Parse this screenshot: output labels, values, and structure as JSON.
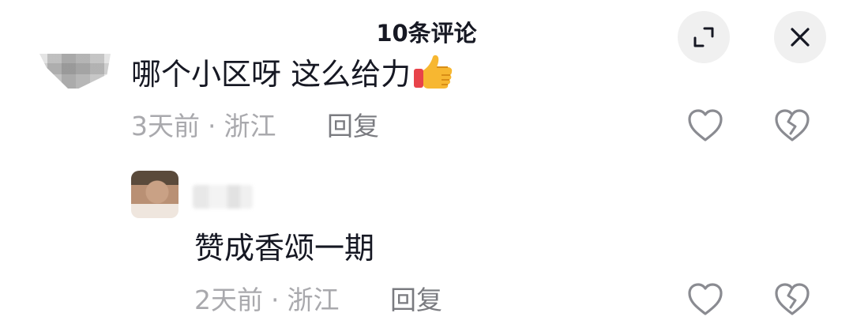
{
  "header": {
    "title": "10条评论"
  },
  "comments": [
    {
      "text": "哪个小区呀 这么给力",
      "time": "3天前",
      "location": "浙江",
      "reply_label": "回复",
      "emoji": "thumbs-up-icon"
    },
    {
      "text": "赞成香颂一期",
      "time": "2天前",
      "location": "浙江",
      "reply_label": "回复"
    }
  ],
  "meta_separator": "·",
  "icons": {
    "expand": "expand-icon",
    "close": "close-icon",
    "like": "heart-outline-icon",
    "dislike": "broken-heart-icon"
  },
  "colors": {
    "text": "#161823",
    "muted": "#a9a9ad",
    "reply": "#7a7b80",
    "button_bg": "#f0f0f0"
  }
}
